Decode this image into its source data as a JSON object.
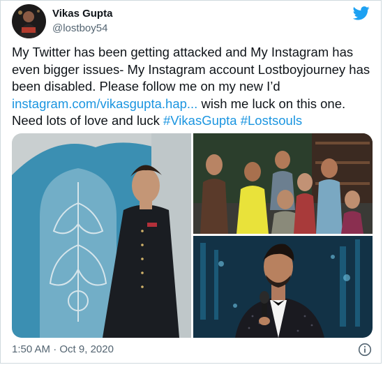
{
  "author": {
    "display_name": "Vikas Gupta",
    "handle": "@lostboy54"
  },
  "tweet": {
    "text_plain": "My Twitter has been getting attacked and My Instagram has even bigger issues- My Instagram account Lostboyjourney has been disabled. Please follow me on my new I’d ",
    "link": "instagram.com/vikasgupta.hap...",
    "text_after_link": " wish me luck on this one. Need lots of love and luck ",
    "hashtags": [
      "#VikasGupta",
      "#Lostsouls"
    ]
  },
  "footer": {
    "time": "1:50 AM",
    "separator": " · ",
    "date": "Oct 9, 2020"
  },
  "icons": {
    "brand": "twitter-bird-icon",
    "info": "info-icon"
  },
  "colors": {
    "link": "#1b95e0",
    "brand": "#1da1f2",
    "secondary_text": "#536471"
  }
}
